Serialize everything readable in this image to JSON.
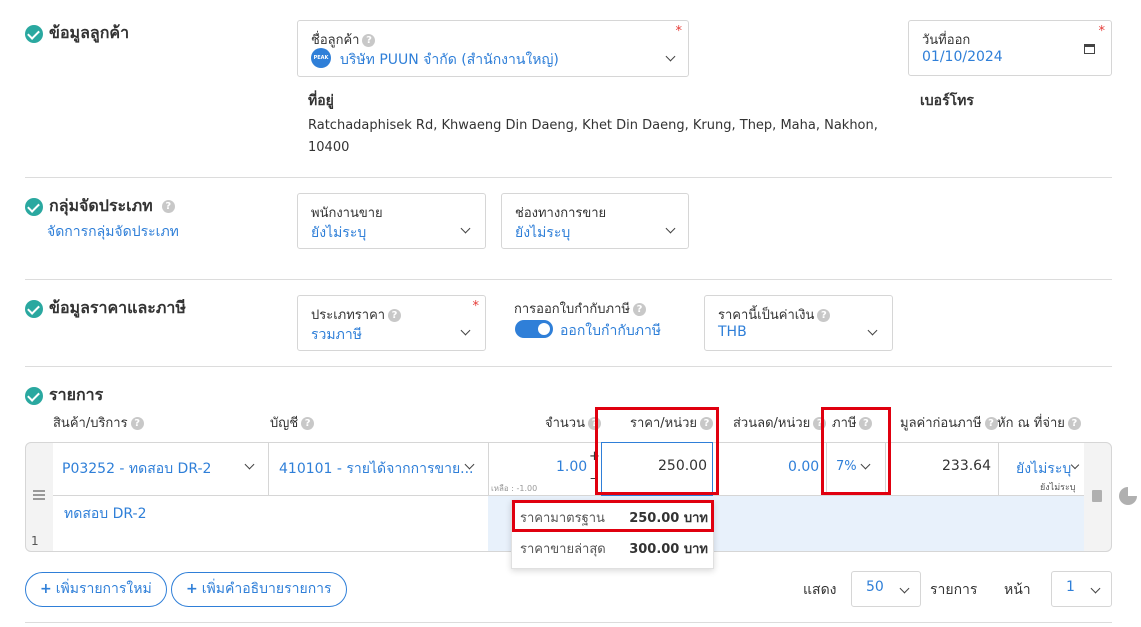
{
  "customer": {
    "section_title": "ข้อมูลลูกค้า",
    "name_label": "ชื่อลูกค้า",
    "logo_text": "PEAK",
    "name_value": "บริษัท PUUN จำกัด (สำนักงานใหญ่)",
    "date_label": "วันที่ออก",
    "date_value": "01/10/2024",
    "address_label": "ที่อยู่",
    "address_line1": "Ratchadaphisek Rd, Khwaeng Din Daeng, Khet Din Daeng, Krung, Thep, Maha, Nakhon,",
    "address_line2": "10400",
    "phone_label": "เบอร์โทร"
  },
  "category": {
    "section_title": "กลุ่มจัดประเภท",
    "manage_link": "จัดการกลุ่มจัดประเภท",
    "salesperson_label": "พนักงานขาย",
    "salesperson_value": "ยังไม่ระบุ",
    "channel_label": "ช่องทางการขาย",
    "channel_value": "ยังไม่ระบุ"
  },
  "pricing": {
    "section_title": "ข้อมูลราคาและภาษี",
    "price_type_label": "ประเภทราคา",
    "price_type_value": "รวมภาษี",
    "tax_invoice_label": "การออกใบกำกับภาษี",
    "tax_invoice_value": "ออกใบกำกับภาษี",
    "currency_label": "ราคานี้เป็นค่าเงิน",
    "currency_value": "THB"
  },
  "items": {
    "section_title": "รายการ",
    "headers": {
      "product": "สินค้า/บริการ",
      "account": "บัญชี",
      "qty": "จำนวน",
      "unit_price": "ราคา/หน่วย",
      "discount": "ส่วนลด/หน่วย",
      "tax": "ภาษี",
      "pre_tax": "มูลค่าก่อนภาษี",
      "withholding": "หัก ณ ที่จ่าย"
    },
    "row": {
      "number": "1",
      "product": "P03252 - ทดสอบ DR-2",
      "account": "410101 - รายได้จากการขาย...",
      "qty": "1.00",
      "remaining": "เหลือ : -1.00",
      "unit_price": "250.00",
      "discount": "0.00",
      "tax": "7%",
      "pre_tax": "233.64",
      "withholding": "ยังไม่ระบุ",
      "withholding_sub": "ยังไม่ระบุ",
      "description": "ทดสอบ DR-2"
    },
    "price_popup": [
      {
        "label": "ราคามาตรฐาน",
        "value": "250.00 บาท"
      },
      {
        "label": "ราคาขายล่าสุด",
        "value": "300.00 บาท"
      }
    ]
  },
  "footer": {
    "add_item": "เพิ่มรายการใหม่",
    "add_desc": "เพิ่มคำอธิบายรายการ",
    "show_label": "แสดง",
    "page_size": "50",
    "items_label": "รายการ",
    "page_label": "หน้า",
    "page_value": "1"
  },
  "colors": {
    "accent": "#2f7fd8",
    "check": "#2aa8a0",
    "highlight": "#e0000f"
  }
}
